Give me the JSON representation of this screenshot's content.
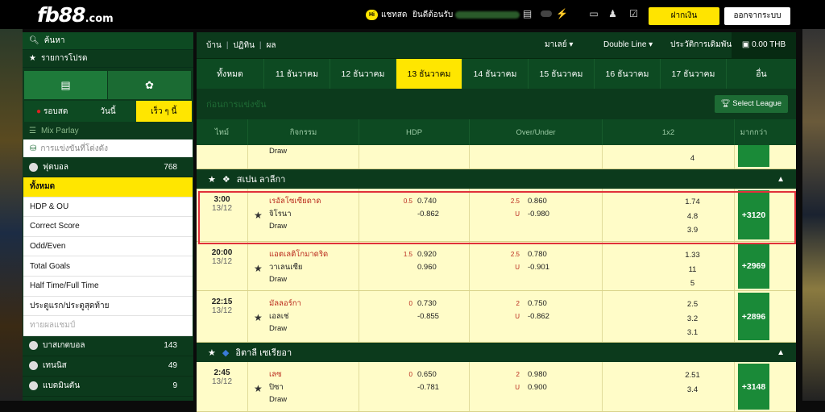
{
  "header": {
    "logo": "fb88",
    "logo_suffix": ".com",
    "chat_badge": "Hi",
    "chat_label": "แชทสด",
    "welcome": "ยินดีต้อนรับ",
    "deposit": "ฝากเงิน",
    "logout": "ออกจากระบบ"
  },
  "sidebar": {
    "search": "ค้นหา",
    "favorites": "รายการโปรด",
    "time_tabs": [
      "รอบสด",
      "วันนี้",
      "เร็ว ๆ นี้"
    ],
    "mix_parlay": "Mix Parlay",
    "upcoming": "การแข่งขันที่โด่งดัง",
    "football": {
      "label": "ฟุตบอล",
      "count": "768"
    },
    "sub_items": [
      "ทั้งหมด",
      "HDP & OU",
      "Correct Score",
      "Odd/Even",
      "Total Goals",
      "Half Time/Full Time",
      "ประตูแรก/ประตูสุดท้าย",
      "ทายผลแชมป์"
    ],
    "sports": [
      {
        "label": "บาสเกตบอล",
        "count": "143"
      },
      {
        "label": "เทนนิส",
        "count": "49"
      },
      {
        "label": "แบดมินตัน",
        "count": "9"
      }
    ]
  },
  "topnav": {
    "crumbs": [
      "บ้าน",
      "ปฏิทิน",
      "ผล"
    ],
    "odds_type": "มาเลย์",
    "line_type": "Double Line",
    "bet_history": "ประวัติการเดิมพัน",
    "balance": "0.00 THB"
  },
  "date_tabs": [
    "ทั้งหมด",
    "11 ธันวาคม",
    "12 ธันวาคม",
    "13 ธันวาคม",
    "14 ธันวาคม",
    "15 ธันวาคม",
    "16 ธันวาคม",
    "17 ธันวาคม",
    "อื่น"
  ],
  "section_title": "ก่อนการแข่งขัน",
  "select_league": "Select League",
  "columns": [
    "ไทม์",
    "กิจกรรม",
    "HDP",
    "Over/Under",
    "1x2",
    "มากกว่า"
  ],
  "partial_row": {
    "draw": "Draw",
    "x2": "4"
  },
  "leagues": [
    {
      "name": "สเปน ลาลีกา",
      "matches": [
        {
          "time": "3:00",
          "date": "13/12",
          "home": "เรอัลโซเซียดาด",
          "away": "จิโรนา",
          "draw": "Draw",
          "hdp_line": "0.5",
          "hdp_home": "0.740",
          "hdp_away": "-0.862",
          "ou_line": "2.5",
          "ou_u": "U",
          "ou_over": "0.860",
          "ou_under": "-0.980",
          "x1": "1.74",
          "xx": "4.8",
          "x2": "3.9",
          "more": "+3120"
        },
        {
          "time": "20:00",
          "date": "13/12",
          "home": "แอตเลติโกมาดริด",
          "away": "วาเลนเซีย",
          "draw": "Draw",
          "hdp_line": "1.5",
          "hdp_home": "0.920",
          "hdp_away": "0.960",
          "ou_line": "2.5",
          "ou_u": "U",
          "ou_over": "0.780",
          "ou_under": "-0.901",
          "x1": "1.33",
          "xx": "11",
          "x2": "5",
          "more": "+2969"
        },
        {
          "time": "22:15",
          "date": "13/12",
          "home": "มัลลอร์กา",
          "away": "เอลเช่",
          "draw": "Draw",
          "hdp_line": "0",
          "hdp_home": "0.730",
          "hdp_away": "-0.855",
          "ou_line": "2",
          "ou_u": "U",
          "ou_over": "0.750",
          "ou_under": "-0.862",
          "x1": "2.5",
          "xx": "3.2",
          "x2": "3.1",
          "more": "+2896"
        }
      ]
    },
    {
      "name": "อิตาลี เซเรียอา",
      "matches": [
        {
          "time": "2:45",
          "date": "13/12",
          "home": "เลซ",
          "away": "ปิซา",
          "draw": "Draw",
          "hdp_line": "0",
          "hdp_home": "0.650",
          "hdp_away": "-0.781",
          "ou_line": "2",
          "ou_u": "U",
          "ou_over": "0.980",
          "ou_under": "0.900",
          "x1": "2.51",
          "xx": "3.4",
          "x2": "",
          "more": "+3148"
        }
      ]
    }
  ]
}
